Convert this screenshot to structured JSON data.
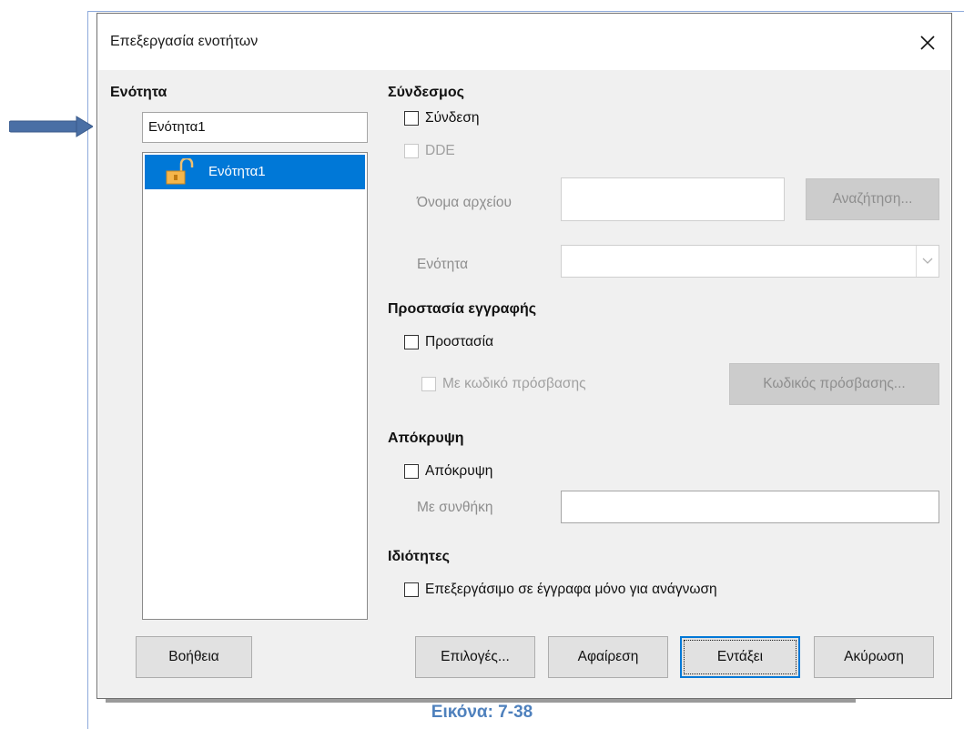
{
  "window": {
    "title": "Επεξεργασία ενοτήτων",
    "close_icon": "close-icon"
  },
  "left_panel": {
    "title": "Ενότητα",
    "name_value": "Ενότητα1",
    "list": [
      {
        "label": "Ενότητα1",
        "icon": "unlocked-padlock-icon",
        "selected": true
      }
    ]
  },
  "link": {
    "title": "Σύνδεσμος",
    "link_checkbox": "Σύνδεση",
    "dde_checkbox": "DDE",
    "filename_label": "Όνομα αρχείου",
    "filename_value": "",
    "browse_button": "Αναζήτηση...",
    "section_label": "Ενότητα",
    "section_value": ""
  },
  "write_protection": {
    "title": "Προστασία εγγραφής",
    "protect_checkbox": "Προστασία",
    "password_checkbox": "Με κωδικό πρόσβασης",
    "password_button": "Κωδικός πρόσβασης..."
  },
  "hide": {
    "title": "Απόκρυψη",
    "hide_checkbox": "Απόκρυψη",
    "condition_label": "Με συνθήκη",
    "condition_value": ""
  },
  "properties": {
    "title": "Ιδιότητες",
    "editable_checkbox": "Επεξεργάσιμο σε έγγραφα μόνο για ανάγνωση"
  },
  "buttons": {
    "help": "Βοήθεια",
    "options": "Επιλογές...",
    "remove": "Αφαίρεση",
    "ok": "Εντάξει",
    "cancel": "Ακύρωση"
  },
  "caption": "Εικόνα: 7-38",
  "colors": {
    "accent": "#0078d7",
    "arrow": "#4a6fa5",
    "caption": "#4f81bd"
  }
}
